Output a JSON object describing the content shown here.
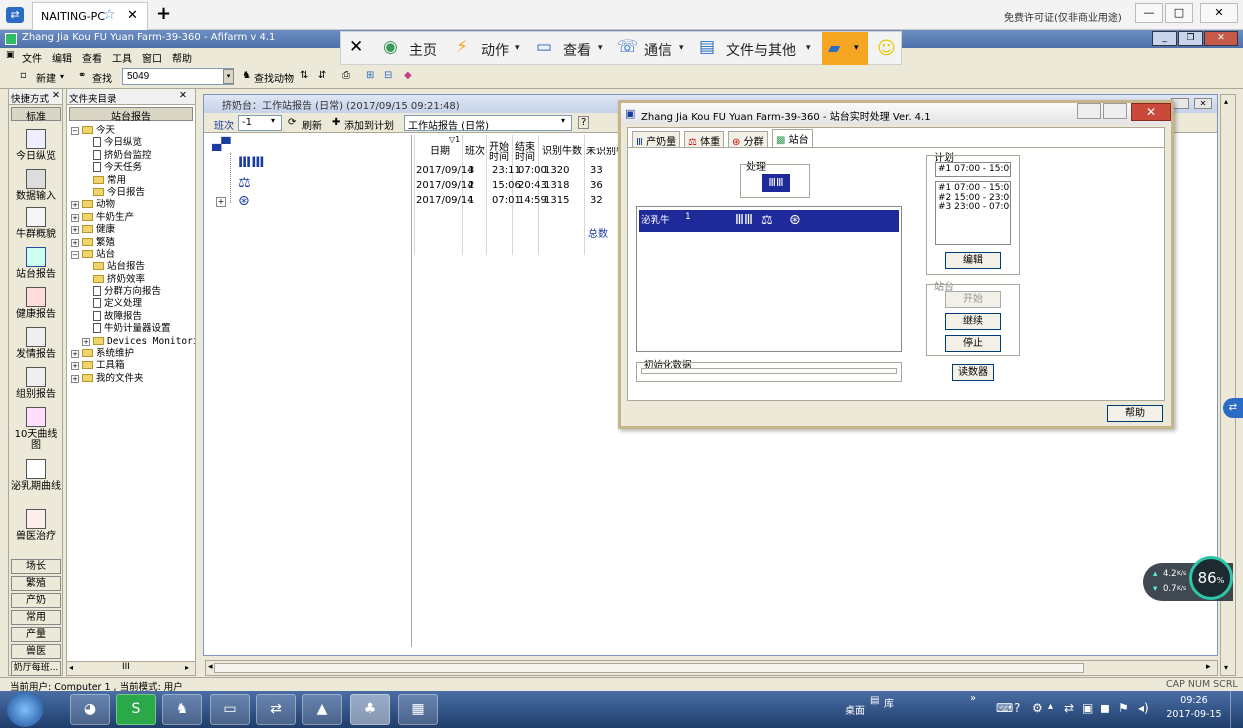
{
  "tv": {
    "tab_label": "NAITING-PC",
    "license": "免费许可证(仅非商业用途)",
    "toolbar": {
      "home": "主页",
      "actions": "动作",
      "view": "查看",
      "comm": "通信",
      "files": "文件与其他"
    }
  },
  "app": {
    "title": "Zhang Jia Kou FU Yuan Farm-39-360 - Afifarm v 4.1",
    "menu": [
      "文件",
      "编辑",
      "查看",
      "工具",
      "窗口",
      "帮助"
    ],
    "toolbar": {
      "new": "新建",
      "search": "查找",
      "search_value": "5049",
      "find_animal": "查找动物"
    }
  },
  "quick": {
    "header": "快捷方式",
    "tab": "标准",
    "items": [
      "今日纵览",
      "数据输入",
      "牛群概貌",
      "站台报告",
      "健康报告",
      "发情报告",
      "组别报告",
      "10天曲线图",
      "泌乳期曲线",
      "兽医治疗"
    ],
    "bottom": [
      "场长",
      "繁殖",
      "产奶",
      "常用",
      "产量",
      "兽医",
      "奶厅每班..."
    ]
  },
  "folders": {
    "header": "文件夹目录",
    "tab": "站台报告",
    "tree": [
      {
        "label": "今天",
        "level": 0,
        "type": "folder",
        "expanded": true
      },
      {
        "label": "今日纵览",
        "level": 2,
        "type": "doc"
      },
      {
        "label": "挤奶台监控",
        "level": 2,
        "type": "doc"
      },
      {
        "label": "今天任务",
        "level": 2,
        "type": "doc"
      },
      {
        "label": "常用",
        "level": 2,
        "type": "folder"
      },
      {
        "label": "今日报告",
        "level": 2,
        "type": "folder"
      },
      {
        "label": "动物",
        "level": 0,
        "type": "folder"
      },
      {
        "label": "牛奶生产",
        "level": 0,
        "type": "folder"
      },
      {
        "label": "健康",
        "level": 0,
        "type": "folder"
      },
      {
        "label": "繁殖",
        "level": 0,
        "type": "folder"
      },
      {
        "label": "站台",
        "level": 0,
        "type": "folder",
        "expanded": true
      },
      {
        "label": "站台报告",
        "level": 2,
        "type": "folder"
      },
      {
        "label": "挤奶效率",
        "level": 2,
        "type": "folder"
      },
      {
        "label": "分群方向报告",
        "level": 2,
        "type": "doc"
      },
      {
        "label": "定义处理",
        "level": 2,
        "type": "doc"
      },
      {
        "label": "故障报告",
        "level": 2,
        "type": "doc"
      },
      {
        "label": "牛奶计量器设置",
        "level": 2,
        "type": "doc"
      },
      {
        "label": "Devices Monitoring",
        "level": 1,
        "type": "folder"
      },
      {
        "label": "系统维护",
        "level": 0,
        "type": "folder"
      },
      {
        "label": "工具箱",
        "level": 0,
        "type": "folder"
      },
      {
        "label": "我的文件夹",
        "level": 0,
        "type": "folder"
      }
    ]
  },
  "report": {
    "title": "挤奶台：工作站报告 (日常) (2017/09/15 09:21:48)",
    "shift_label": "班次",
    "shift_value": "-1",
    "refresh": "刷新",
    "add_plan": "添加到计划",
    "report_type": "工作站报告 (日常)",
    "columns": [
      "日期",
      "班次",
      "开始时间",
      "结束时间",
      "识别牛数",
      "未识别牛"
    ],
    "rows": [
      [
        "2017/09/14",
        "3",
        "23:11",
        "07:00",
        "1320",
        "33"
      ],
      [
        "2017/09/14",
        "2",
        "15:06",
        "20:43",
        "1318",
        "36"
      ],
      [
        "2017/09/14",
        "1",
        "07:01",
        "14:59",
        "1315",
        "32"
      ]
    ],
    "total": "总数"
  },
  "dialog": {
    "title": "Zhang Jia Kou FU Yuan Farm-39-360 - 站台实时处理 Ver. 4.1",
    "tabs": [
      "产奶量",
      "体重",
      "分群",
      "站台"
    ],
    "process_label": "处理",
    "row_label": "泌乳牛",
    "row_num": "1",
    "init_label": "初始化数据",
    "plan_label": "计划",
    "plan_current": "#1 07:00 - 15:00",
    "plan_list": [
      "#1 07:00 - 15:00",
      "#2 15:00 - 23:00",
      "#3 23:00 - 07:00"
    ],
    "edit": "编辑",
    "station_label": "站台",
    "start": "开始",
    "continue": "继续",
    "stop": "停止",
    "counter": "读数器",
    "help": "帮助"
  },
  "status": {
    "left": "当前用户: Computer 1 , 当前模式: 用户",
    "right": "CAP  NUM  SCRL"
  },
  "netmon": {
    "up": "4.2",
    "down": "0.7",
    "unit": "K/s",
    "pct": "86",
    "pct_sign": "%"
  },
  "taskbar": {
    "desktop": "桌面",
    "library": "库",
    "time": "09:26",
    "date": "2017-09-15"
  }
}
